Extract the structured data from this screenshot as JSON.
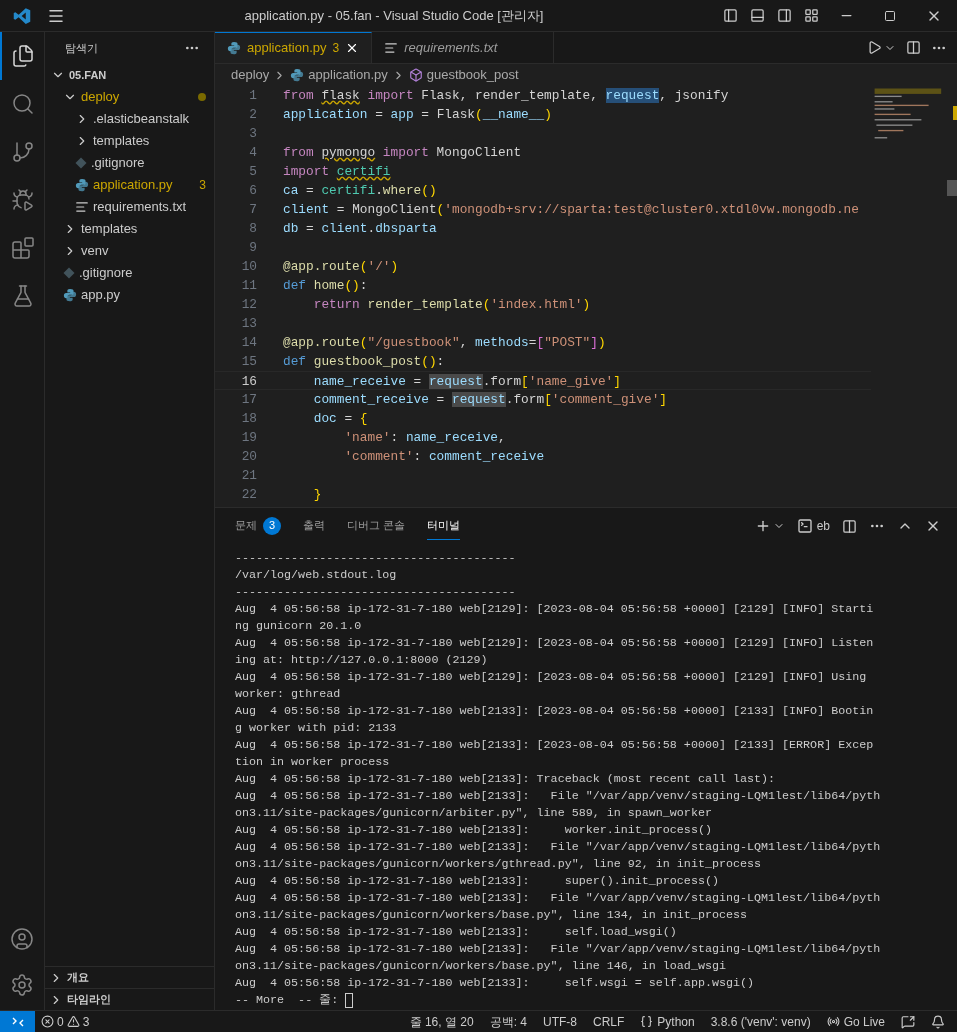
{
  "window": {
    "title": "application.py - 05.fan - Visual Studio Code [관리자]"
  },
  "activity_bar": {
    "items": [
      {
        "kind": "files",
        "selected": true
      },
      {
        "kind": "search",
        "selected": false
      },
      {
        "kind": "scm",
        "selected": false
      },
      {
        "kind": "debug",
        "selected": false
      },
      {
        "kind": "extensions",
        "selected": false
      },
      {
        "kind": "testing",
        "selected": false
      }
    ]
  },
  "sidebar": {
    "title": "탐색기",
    "root": "05.FAN",
    "tree": [
      {
        "label": "deploy",
        "kind": "folder",
        "expanded": true,
        "warning": true,
        "children": [
          {
            "label": ".elasticbeanstalk",
            "kind": "folder",
            "expanded": false,
            "warning": false
          },
          {
            "label": "templates",
            "kind": "folder",
            "expanded": false,
            "warning": false
          },
          {
            "label": ".gitignore",
            "kind": "git",
            "warning": false
          },
          {
            "label": "application.py",
            "kind": "python",
            "warning": true,
            "problems": "3"
          },
          {
            "label": "requirements.txt",
            "kind": "text",
            "warning": false
          }
        ]
      },
      {
        "label": "templates",
        "kind": "folder",
        "expanded": false,
        "warning": false
      },
      {
        "label": "venv",
        "kind": "folder",
        "expanded": false,
        "warning": false
      },
      {
        "label": ".gitignore",
        "kind": "git",
        "warning": false
      },
      {
        "label": "app.py",
        "kind": "python",
        "warning": false
      }
    ],
    "sections": [
      {
        "label": "개요",
        "expanded": false
      },
      {
        "label": "타임라인",
        "expanded": false
      }
    ]
  },
  "tabs": [
    {
      "label": "application.py",
      "kind": "python",
      "selected": true,
      "preview": false,
      "warning": true,
      "problems": "3"
    },
    {
      "label": "requirements.txt",
      "kind": "text",
      "selected": false,
      "preview": true,
      "warning": false
    }
  ],
  "breadcrumbs": [
    "deploy",
    "application.py",
    "guestbook_post"
  ],
  "editor": {
    "lines": [
      {
        "n": "1",
        "current": false,
        "tokens": [
          {
            "kind": "kw",
            "text": "from "
          },
          {
            "kind": "modwarn",
            "text": "flask"
          },
          {
            "kind": "kw",
            "text": " import "
          },
          {
            "kind": "p",
            "text": "Flask, render_template, "
          },
          {
            "kind": "sel",
            "text": "request"
          },
          {
            "kind": "p",
            "text": ", jsonify"
          }
        ]
      },
      {
        "n": "2",
        "current": false,
        "tokens": [
          {
            "kind": "var",
            "text": "application"
          },
          {
            "kind": "p",
            "text": " = "
          },
          {
            "kind": "var",
            "text": "app"
          },
          {
            "kind": "p",
            "text": " = "
          },
          {
            "kind": "p",
            "text": "Flask"
          },
          {
            "kind": "b1",
            "text": "("
          },
          {
            "kind": "var",
            "text": "__name__"
          },
          {
            "kind": "b1",
            "text": ")"
          }
        ]
      },
      {
        "n": "3",
        "current": false
      },
      {
        "n": "4",
        "current": false,
        "tokens": [
          {
            "kind": "kw",
            "text": "from "
          },
          {
            "kind": "modwarn",
            "text": "pymongo"
          },
          {
            "kind": "kw",
            "text": " import "
          },
          {
            "kind": "p",
            "text": "MongoClient"
          }
        ]
      },
      {
        "n": "5",
        "current": false,
        "tokens": [
          {
            "kind": "kw",
            "text": "import "
          },
          {
            "kind": "clswarn",
            "text": "certifi"
          }
        ]
      },
      {
        "n": "6",
        "current": false,
        "tokens": [
          {
            "kind": "var",
            "text": "ca"
          },
          {
            "kind": "p",
            "text": " = "
          },
          {
            "kind": "cls",
            "text": "certifi"
          },
          {
            "kind": "p",
            "text": "."
          },
          {
            "kind": "fn",
            "text": "where"
          },
          {
            "kind": "b1",
            "text": "()"
          }
        ]
      },
      {
        "n": "7",
        "current": false,
        "tokens": [
          {
            "kind": "var",
            "text": "client"
          },
          {
            "kind": "p",
            "text": " = "
          },
          {
            "kind": "p",
            "text": "MongoClient"
          },
          {
            "kind": "b1",
            "text": "("
          },
          {
            "kind": "str",
            "text": "'mongodb+srv://sparta:test@cluster0.xtdl0vw.mongodb.ne"
          }
        ]
      },
      {
        "n": "8",
        "current": false,
        "tokens": [
          {
            "kind": "var",
            "text": "db"
          },
          {
            "kind": "p",
            "text": " = "
          },
          {
            "kind": "var",
            "text": "client"
          },
          {
            "kind": "p",
            "text": "."
          },
          {
            "kind": "var",
            "text": "dbsparta"
          }
        ]
      },
      {
        "n": "9",
        "current": false
      },
      {
        "n": "10",
        "current": false,
        "tokens": [
          {
            "kind": "fn",
            "text": "@app.route"
          },
          {
            "kind": "b1",
            "text": "("
          },
          {
            "kind": "str",
            "text": "'/'"
          },
          {
            "kind": "b1",
            "text": ")"
          }
        ]
      },
      {
        "n": "11",
        "current": false,
        "tokens": [
          {
            "kind": "ctrl",
            "text": "def "
          },
          {
            "kind": "fn",
            "text": "home"
          },
          {
            "kind": "b1",
            "text": "()"
          },
          {
            "kind": "p",
            "text": ":"
          }
        ]
      },
      {
        "n": "12",
        "current": false,
        "tokens": [
          {
            "kind": "kw",
            "text": "    return "
          },
          {
            "kind": "fn",
            "text": "render_template"
          },
          {
            "kind": "b1",
            "text": "("
          },
          {
            "kind": "str",
            "text": "'index.html'"
          },
          {
            "kind": "b1",
            "text": ")"
          }
        ]
      },
      {
        "n": "13",
        "current": false
      },
      {
        "n": "14",
        "current": false,
        "tokens": [
          {
            "kind": "fn",
            "text": "@app.route"
          },
          {
            "kind": "b1",
            "text": "("
          },
          {
            "kind": "str",
            "text": "\"/guestbook\""
          },
          {
            "kind": "p",
            "text": ", "
          },
          {
            "kind": "var",
            "text": "methods"
          },
          {
            "kind": "p",
            "text": "="
          },
          {
            "kind": "b2",
            "text": "["
          },
          {
            "kind": "str",
            "text": "\"POST\""
          },
          {
            "kind": "b2",
            "text": "]"
          },
          {
            "kind": "b1",
            "text": ")"
          }
        ]
      },
      {
        "n": "15",
        "current": false,
        "tokens": [
          {
            "kind": "ctrl",
            "text": "def "
          },
          {
            "kind": "fn",
            "text": "guestbook_post"
          },
          {
            "kind": "b1",
            "text": "()"
          },
          {
            "kind": "p",
            "text": ":"
          }
        ]
      },
      {
        "n": "16",
        "current": true,
        "tokens": [
          {
            "kind": "var",
            "text": "    name_receive"
          },
          {
            "kind": "p",
            "text": " = "
          },
          {
            "kind": "occ",
            "text": "request"
          },
          {
            "kind": "p",
            "text": ".form"
          },
          {
            "kind": "b1",
            "text": "["
          },
          {
            "kind": "str",
            "text": "'name_give'"
          },
          {
            "kind": "b1",
            "text": "]"
          }
        ]
      },
      {
        "n": "17",
        "current": false,
        "tokens": [
          {
            "kind": "var",
            "text": "    comment_receive"
          },
          {
            "kind": "p",
            "text": " = "
          },
          {
            "kind": "occ",
            "text": "request"
          },
          {
            "kind": "p",
            "text": ".form"
          },
          {
            "kind": "b1",
            "text": "["
          },
          {
            "kind": "str",
            "text": "'comment_give'"
          },
          {
            "kind": "b1",
            "text": "]"
          }
        ]
      },
      {
        "n": "18",
        "current": false,
        "tokens": [
          {
            "kind": "var",
            "text": "    doc"
          },
          {
            "kind": "p",
            "text": " = "
          },
          {
            "kind": "b1",
            "text": "{"
          }
        ]
      },
      {
        "n": "19",
        "current": false,
        "tokens": [
          {
            "kind": "str",
            "text": "        'name'"
          },
          {
            "kind": "p",
            "text": ": "
          },
          {
            "kind": "var",
            "text": "name_receive"
          },
          {
            "kind": "p",
            "text": ","
          }
        ]
      },
      {
        "n": "20",
        "current": false,
        "tokens": [
          {
            "kind": "str",
            "text": "        'comment'"
          },
          {
            "kind": "p",
            "text": ": "
          },
          {
            "kind": "var",
            "text": "comment_receive"
          }
        ]
      },
      {
        "n": "21",
        "current": false
      },
      {
        "n": "22",
        "current": false,
        "tokens": [
          {
            "kind": "b1",
            "text": "    }"
          }
        ]
      }
    ]
  },
  "panel": {
    "tabs": [
      {
        "label": "문제",
        "badge": "3",
        "selected": false
      },
      {
        "label": "출력",
        "selected": false
      },
      {
        "label": "디버그 콘솔",
        "selected": false
      },
      {
        "label": "터미널",
        "selected": true
      }
    ],
    "terminal_name": "eb",
    "lines": [
      "----------------------------------------",
      "/var/log/web.stdout.log",
      "----------------------------------------",
      "Aug  4 05:56:58 ip-172-31-7-180 web[2129]: [2023-08-04 05:56:58 +0000] [2129] [INFO] Starti",
      "ng gunicorn 20.1.0",
      "Aug  4 05:56:58 ip-172-31-7-180 web[2129]: [2023-08-04 05:56:58 +0000] [2129] [INFO] Listen",
      "ing at: http://127.0.0.1:8000 (2129)",
      "Aug  4 05:56:58 ip-172-31-7-180 web[2129]: [2023-08-04 05:56:58 +0000] [2129] [INFO] Using",
      "worker: gthread",
      "Aug  4 05:56:58 ip-172-31-7-180 web[2133]: [2023-08-04 05:56:58 +0000] [2133] [INFO] Bootin",
      "g worker with pid: 2133",
      "Aug  4 05:56:58 ip-172-31-7-180 web[2133]: [2023-08-04 05:56:58 +0000] [2133] [ERROR] Excep",
      "tion in worker process",
      "Aug  4 05:56:58 ip-172-31-7-180 web[2133]: Traceback (most recent call last):",
      "Aug  4 05:56:58 ip-172-31-7-180 web[2133]:   File \"/var/app/venv/staging-LQM1lest/lib64/pyth",
      "on3.11/site-packages/gunicorn/arbiter.py\", line 589, in spawn_worker",
      "Aug  4 05:56:58 ip-172-31-7-180 web[2133]:     worker.init_process()",
      "Aug  4 05:56:58 ip-172-31-7-180 web[2133]:   File \"/var/app/venv/staging-LQM1lest/lib64/pyth",
      "on3.11/site-packages/gunicorn/workers/gthread.py\", line 92, in init_process",
      "Aug  4 05:56:58 ip-172-31-7-180 web[2133]:     super().init_process()",
      "Aug  4 05:56:58 ip-172-31-7-180 web[2133]:   File \"/var/app/venv/staging-LQM1lest/lib64/pyth",
      "on3.11/site-packages/gunicorn/workers/base.py\", line 134, in init_process",
      "Aug  4 05:56:58 ip-172-31-7-180 web[2133]:     self.load_wsgi()",
      "Aug  4 05:56:58 ip-172-31-7-180 web[2133]:   File \"/var/app/venv/staging-LQM1lest/lib64/pyth",
      "on3.11/site-packages/gunicorn/workers/base.py\", line 146, in load_wsgi",
      "Aug  4 05:56:58 ip-172-31-7-180 web[2133]:     self.wsgi = self.app.wsgi()"
    ],
    "prompt": "-- More  -- 줄: "
  },
  "status_bar": {
    "errors": "0",
    "warnings": "3",
    "position": "줄 16, 열 20",
    "indent": "공백: 4",
    "encoding": "UTF-8",
    "eol": "CRLF",
    "language": "Python",
    "interpreter": "3.8.6 ('venv': venv)",
    "live": "Go Live"
  }
}
